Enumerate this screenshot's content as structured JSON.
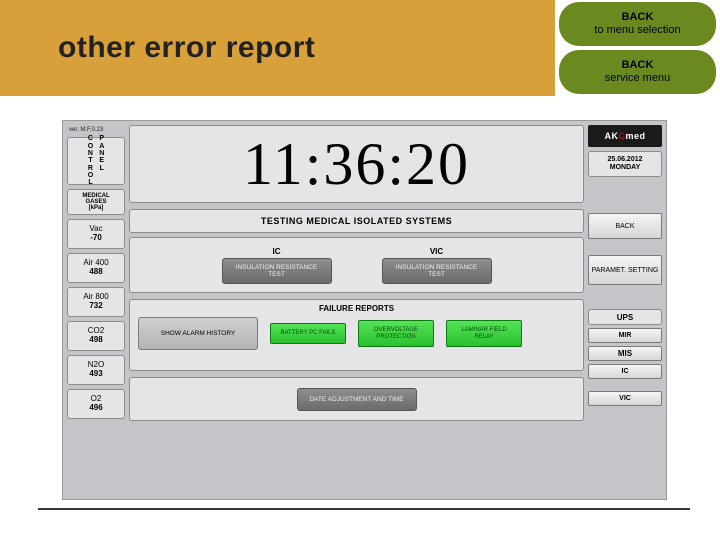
{
  "banner": {
    "title": "other error report",
    "back_menu_line1": "BACK",
    "back_menu_line2": "to  menu  selection",
    "back_service_line1": "BACK",
    "back_service_line2": "service menu"
  },
  "version": "ver. M.F.0.23",
  "control_panel": {
    "col1": [
      "C",
      "O",
      "N",
      "T",
      "R",
      "O",
      "L"
    ],
    "col2": [
      "P",
      "A",
      "N",
      "E",
      "L"
    ]
  },
  "medical_gases_header": {
    "l1": "MEDICAL",
    "l2": "GASES",
    "l3": "[kPa]"
  },
  "gases": [
    {
      "name": "Vac",
      "value": "-70"
    },
    {
      "name": "Air 400",
      "value": "488"
    },
    {
      "name": "Air 800",
      "value": "732"
    },
    {
      "name": "CO2",
      "value": "498"
    },
    {
      "name": "N2O",
      "value": "493"
    },
    {
      "name": "O2",
      "value": "496"
    }
  ],
  "clock": "11:36:20",
  "testing_header": "TESTING MEDICAL ISOLATED SYSTEMS",
  "tests": {
    "ic_label": "IC",
    "ic_btn": "INSULATION RESISTANCE TEST",
    "vic_label": "VIC",
    "vic_btn": "INSULATION RESISTANCE TEST"
  },
  "failure": {
    "header": "FAILURE REPORTS",
    "history": "SHOW ALARM HISTORY",
    "b1": "BATTERY PC FAILS",
    "b2": "OVERVOLTAGE PROTECTION",
    "b3": "LAMINAR FIELD RELAY"
  },
  "date_adjust": "DATE ADJUSTMENT AND TIME",
  "brand": {
    "a": "AK",
    "b": "C",
    "c": "med"
  },
  "date": {
    "d": "25.06.2012",
    "w": "MONDAY"
  },
  "right_buttons": {
    "back": "BACK",
    "param": "PARAMET. SETTING"
  },
  "ups": {
    "header": "UPS",
    "r1": "MIR",
    "r2": "MIS",
    "r3": "IC",
    "r4": "VIC"
  }
}
